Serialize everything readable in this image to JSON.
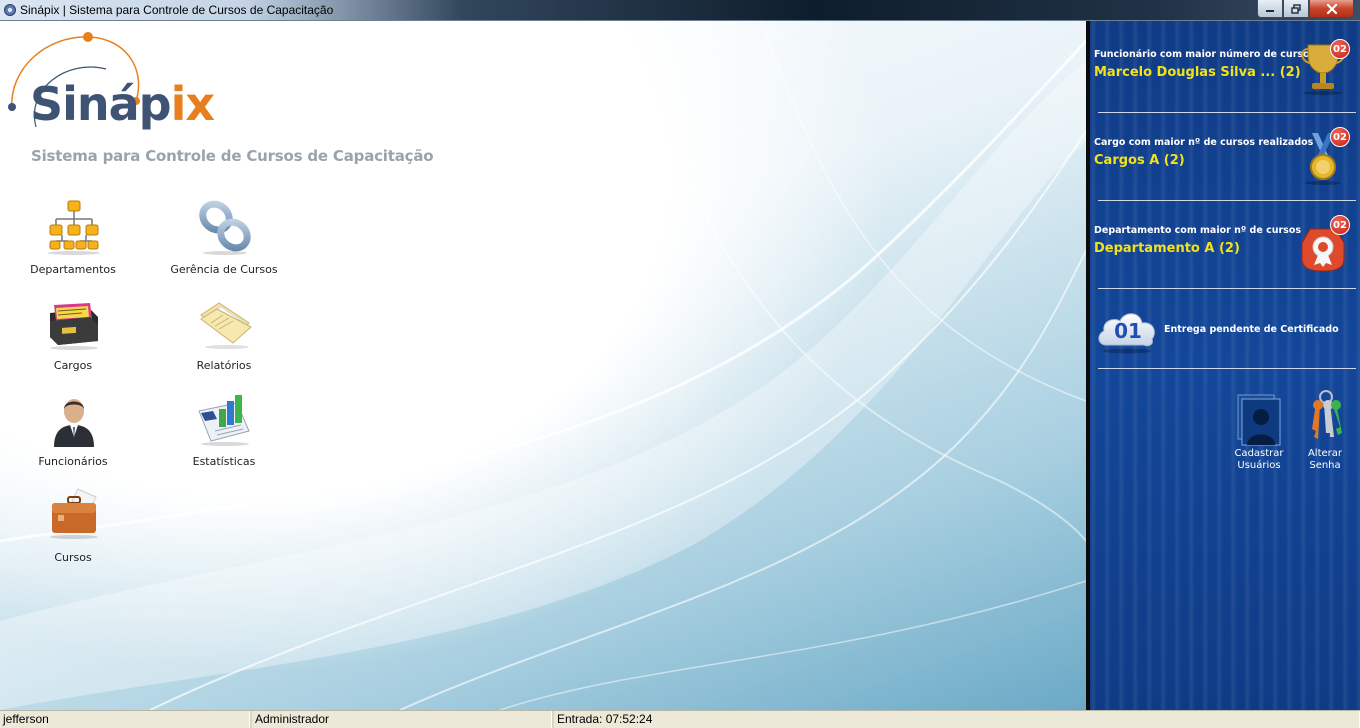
{
  "window": {
    "title": "Sinápix | Sistema para Controle de Cursos de Capacitação",
    "icons": {
      "app": "gear-icon",
      "minimize": "minimize-icon",
      "maximize": "restore-icon",
      "close": "close-icon"
    }
  },
  "logo": {
    "word_main": "Sináp",
    "word_accent": "ix",
    "tagline": "Sistema para Controle de Cursos de Capacitação"
  },
  "menu": {
    "departamentos": {
      "label": "Departamentos",
      "icon": "org-chart-icon"
    },
    "gerencia_cursos": {
      "label": "Gerência de Cursos",
      "icon": "chain-link-icon"
    },
    "cargos": {
      "label": "Cargos",
      "icon": "card-file-icon"
    },
    "relatorios": {
      "label": "Relatórios",
      "icon": "folder-icon"
    },
    "funcionarios": {
      "label": "Funcionários",
      "icon": "businessman-icon"
    },
    "estatisticas": {
      "label": "Estatísticas",
      "icon": "bar-chart-icon"
    },
    "cursos": {
      "label": "Cursos",
      "icon": "briefcase-icon"
    }
  },
  "panel": {
    "stats": [
      {
        "caption": "Funcionário com maior número de cursos",
        "value": "Marcelo Douglas Silva ... (2)",
        "badge": "02",
        "icon": "trophy-icon"
      },
      {
        "caption": "Cargo com maior nº de cursos realizados",
        "value": "Cargos A (2)",
        "badge": "02",
        "icon": "medal-icon"
      },
      {
        "caption": "Departamento com maior nº de cursos",
        "value": "Departamento A (2)",
        "badge": "02",
        "icon": "award-ribbon-icon"
      }
    ],
    "pending": {
      "count": "01",
      "label": "Entrega pendente de Certificado",
      "icon": "cloud-icon"
    },
    "actions": {
      "cadastrar": {
        "line1": "Cadastrar",
        "line2": "Usuários",
        "icon": "users-icon"
      },
      "alterar": {
        "line1": "Alterar",
        "line2": "Senha",
        "icon": "keys-icon"
      }
    },
    "colors": {
      "background": "#13479a",
      "highlight": "#f2e21b",
      "badge": "#c41d12"
    }
  },
  "status": {
    "user": "jefferson",
    "role": "Administrador",
    "entry": "Entrada: 07:52:24"
  }
}
